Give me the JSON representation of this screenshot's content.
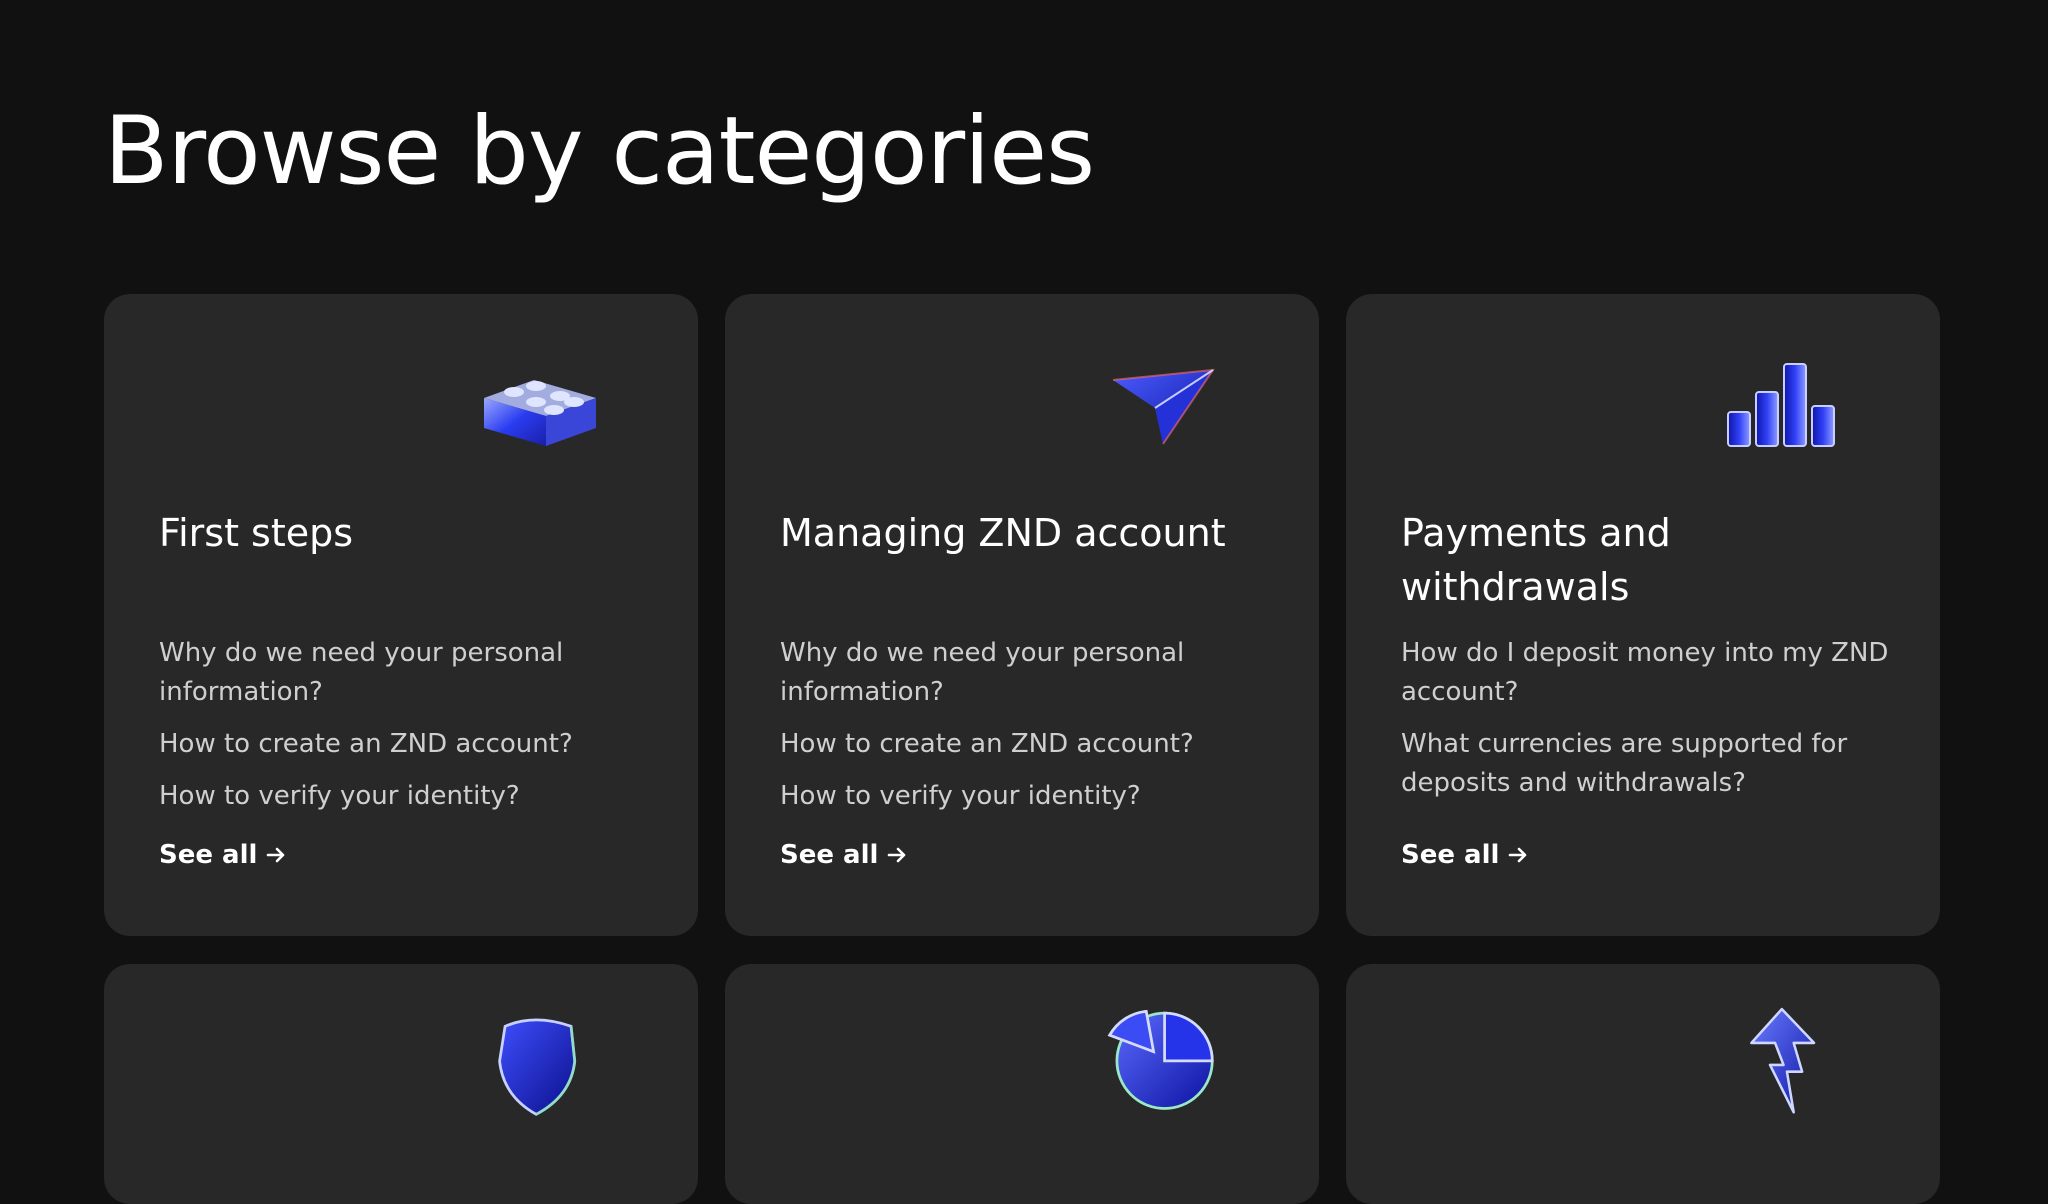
{
  "page": {
    "title": "Browse by categories"
  },
  "theme": {
    "background": "#111111",
    "card_background": "#282828",
    "text_primary": "#ffffff",
    "text_secondary": "#cfcfcf",
    "icon_accent": "#2a3cf0"
  },
  "categories": [
    {
      "title": "First steps",
      "icon": "lego-brick-icon",
      "links": [
        "Why do we need your personal information?",
        "How to create an ZND account?",
        "How to verify your identity?"
      ],
      "see_all_label": "See all"
    },
    {
      "title": "Managing ZND account",
      "icon": "paper-plane-icon",
      "links": [
        "Why do we need your personal information?",
        "How to create an ZND account?",
        "How to verify your identity?"
      ],
      "see_all_label": "See all"
    },
    {
      "title": "Payments and withdrawals",
      "icon": "bar-chart-icon",
      "links": [
        "How do I deposit money into my ZND account?",
        "What currencies are supported for deposits and withdrawals?"
      ],
      "see_all_label": "See all"
    },
    {
      "icon": "shield-icon"
    },
    {
      "icon": "pie-chart-icon"
    },
    {
      "icon": "lightning-arrow-icon"
    }
  ]
}
